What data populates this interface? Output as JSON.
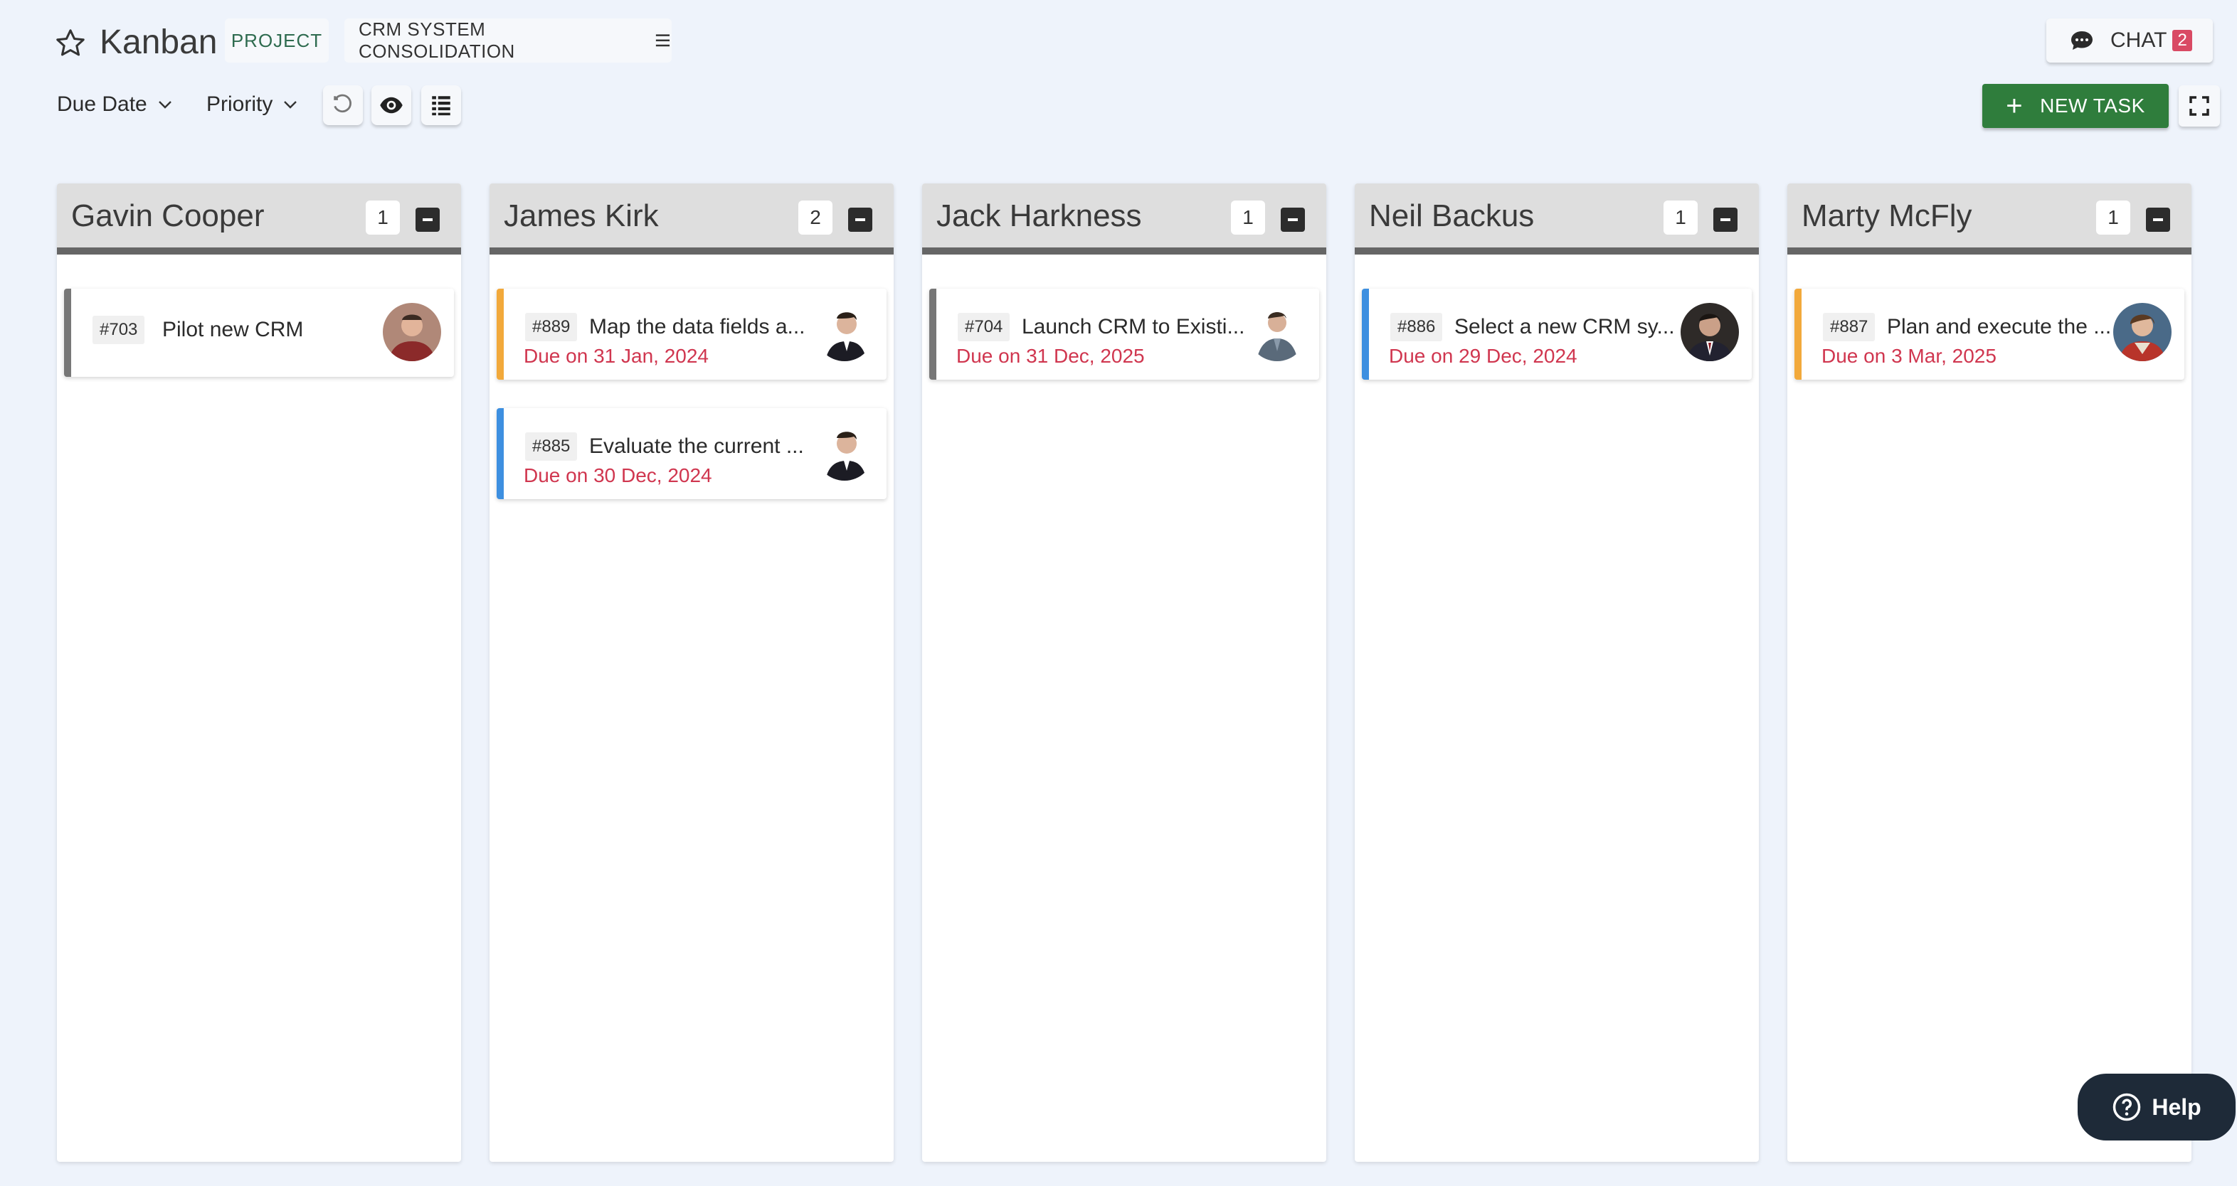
{
  "header": {
    "title": "Kanban",
    "project_chip": "PROJECT",
    "project_name": "CRM SYSTEM CONSOLIDATION",
    "chat_label": "CHAT",
    "chat_count": "2"
  },
  "toolbar": {
    "sort_label": "Due Date",
    "group_label": "Priority",
    "new_task_label": "NEW TASK"
  },
  "columns": [
    {
      "name": "Gavin Cooper",
      "count": "1"
    },
    {
      "name": "James Kirk",
      "count": "2"
    },
    {
      "name": "Jack Harkness",
      "count": "1"
    },
    {
      "name": "Neil Backus",
      "count": "1"
    },
    {
      "name": "Marty McFly",
      "count": "1"
    }
  ],
  "cards": [
    {
      "id": "#703",
      "title": "Pilot new CRM",
      "due": "",
      "priority_color": "#777777"
    },
    {
      "id": "#889",
      "title": "Map the data fields a...",
      "due": "Due on 31 Jan, 2024",
      "priority_color": "#f2a93b"
    },
    {
      "id": "#885",
      "title": "Evaluate the current ...",
      "due": "Due on 30 Dec, 2024",
      "priority_color": "#3d8fe0"
    },
    {
      "id": "#704",
      "title": "Launch CRM to Existi...",
      "due": "Due on 31 Dec, 2025",
      "priority_color": "#777777"
    },
    {
      "id": "#886",
      "title": "Select a new CRM sy...",
      "due": "Due on 29 Dec, 2024",
      "priority_color": "#3d8fe0"
    },
    {
      "id": "#887",
      "title": "Plan and execute the ...",
      "due": "Due on 3 Mar, 2025",
      "priority_color": "#f2a93b"
    }
  ],
  "help_label": "Help",
  "colors": {
    "accent_green": "#2f7d3c",
    "due_red": "#d0364f",
    "background": "#eef3fb"
  }
}
